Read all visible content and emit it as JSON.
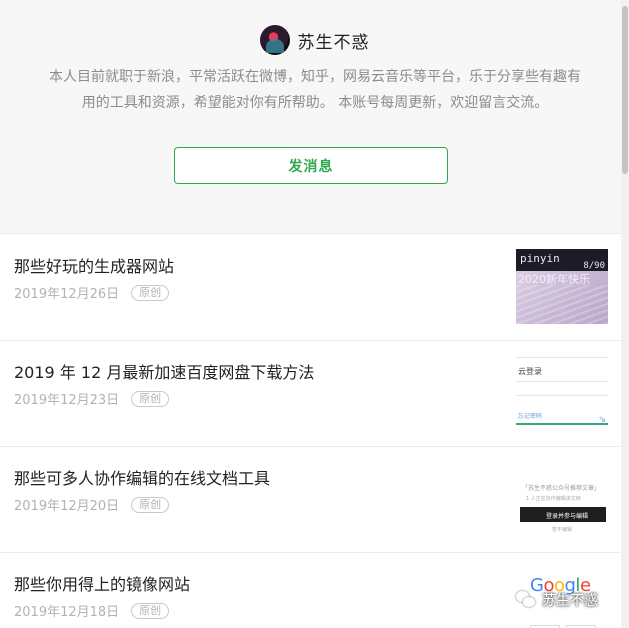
{
  "profile": {
    "name": "苏生不惑",
    "description_line1": "本人目前就职于新浪，平常活跃在微博，知乎，网易云音乐等平台，乐于分享些有趣有",
    "description_line2": "用的工具和资源，希望能对你有所帮助。 本账号每周更新，欢迎留言交流。",
    "message_button_label": "发消息"
  },
  "articles": [
    {
      "title": "那些好玩的生成器网站",
      "date": "2019年12月26日",
      "tag": "原创"
    },
    {
      "title": "2019 年 12 月最新加速百度网盘下载方法",
      "date": "2019年12月23日",
      "tag": "原创"
    },
    {
      "title": "那些可多人协作编辑的在线文档工具",
      "date": "2019年12月20日",
      "tag": "原创"
    },
    {
      "title": "那些你用得上的镜像网站",
      "date": "2019年12月18日",
      "tag": "原创"
    }
  ],
  "thumbnails": {
    "t1": {
      "band_text": "pinyin",
      "band_num": "8/90",
      "sub": "2020新年快乐"
    },
    "t2": {
      "title": "云登录",
      "link": "忘记密码",
      "glyph": "⇘"
    },
    "t3": {
      "line1": "「苏生不惑公众号推荐文章」",
      "line2": "1 人正在协作编辑该文档",
      "button": "登录并参与编辑",
      "line3": "暂不编辑"
    },
    "t4": {
      "logo": "Google"
    }
  },
  "watermark": {
    "text": "苏生不惑"
  },
  "colors": {
    "accent": "#2fa84f",
    "muted": "#b2b2b2"
  }
}
